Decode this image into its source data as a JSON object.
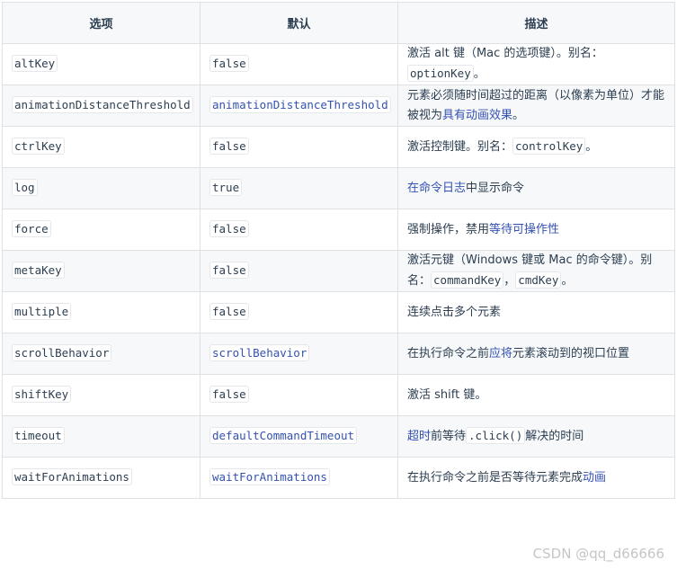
{
  "header": {
    "option": "选项",
    "default": "默认",
    "description": "描述"
  },
  "rows": [
    {
      "option": "altKey",
      "default": "false",
      "d1": "激活 alt 键（Mac 的选项键）。别名：",
      "code1": "optionKey",
      "d2": "。"
    },
    {
      "option": "animationDistanceThreshold",
      "default": "animationDistanceThreshold",
      "d1": "元素必须随时间超过的距离（以像素为单位）才能被视为",
      "link1": "具有动画效果",
      "d2": "。"
    },
    {
      "option": "ctrlKey",
      "default": "false",
      "d1": "激活控制键。别名：",
      "code1": "controlKey",
      "d2": "。"
    },
    {
      "option": "log",
      "default": "true",
      "link1": "在命令日志",
      "d2": "中显示命令"
    },
    {
      "option": "force",
      "default": "false",
      "d1": "强制操作，禁用",
      "link1": "等待可操作性"
    },
    {
      "option": "metaKey",
      "default": "false",
      "d1": "激活元键（Windows 键或 Mac 的命令键）。别名：",
      "code1": "commandKey",
      "sep": "，",
      "code2": "cmdKey",
      "d2": "。"
    },
    {
      "option": "multiple",
      "default": "false",
      "d1": "连续点击多个元素"
    },
    {
      "option": "scrollBehavior",
      "default": "scrollBehavior",
      "d1": "在执行命令之前",
      "link1": "应将",
      "d2": "元素滚动到的视口位置"
    },
    {
      "option": "shiftKey",
      "default": "false",
      "d1": "激活 shift 键。"
    },
    {
      "option": "timeout",
      "default": "defaultCommandTimeout",
      "link1": "超时",
      "d1": "前等待",
      "code1": ".click()",
      "d2": "解决的时间"
    },
    {
      "option": "waitForAnimations",
      "default": "waitForAnimations",
      "d1": "在执行命令之前是否等待元素完成",
      "link1": "动画"
    }
  ],
  "watermark": "CSDN @qq_d66666"
}
